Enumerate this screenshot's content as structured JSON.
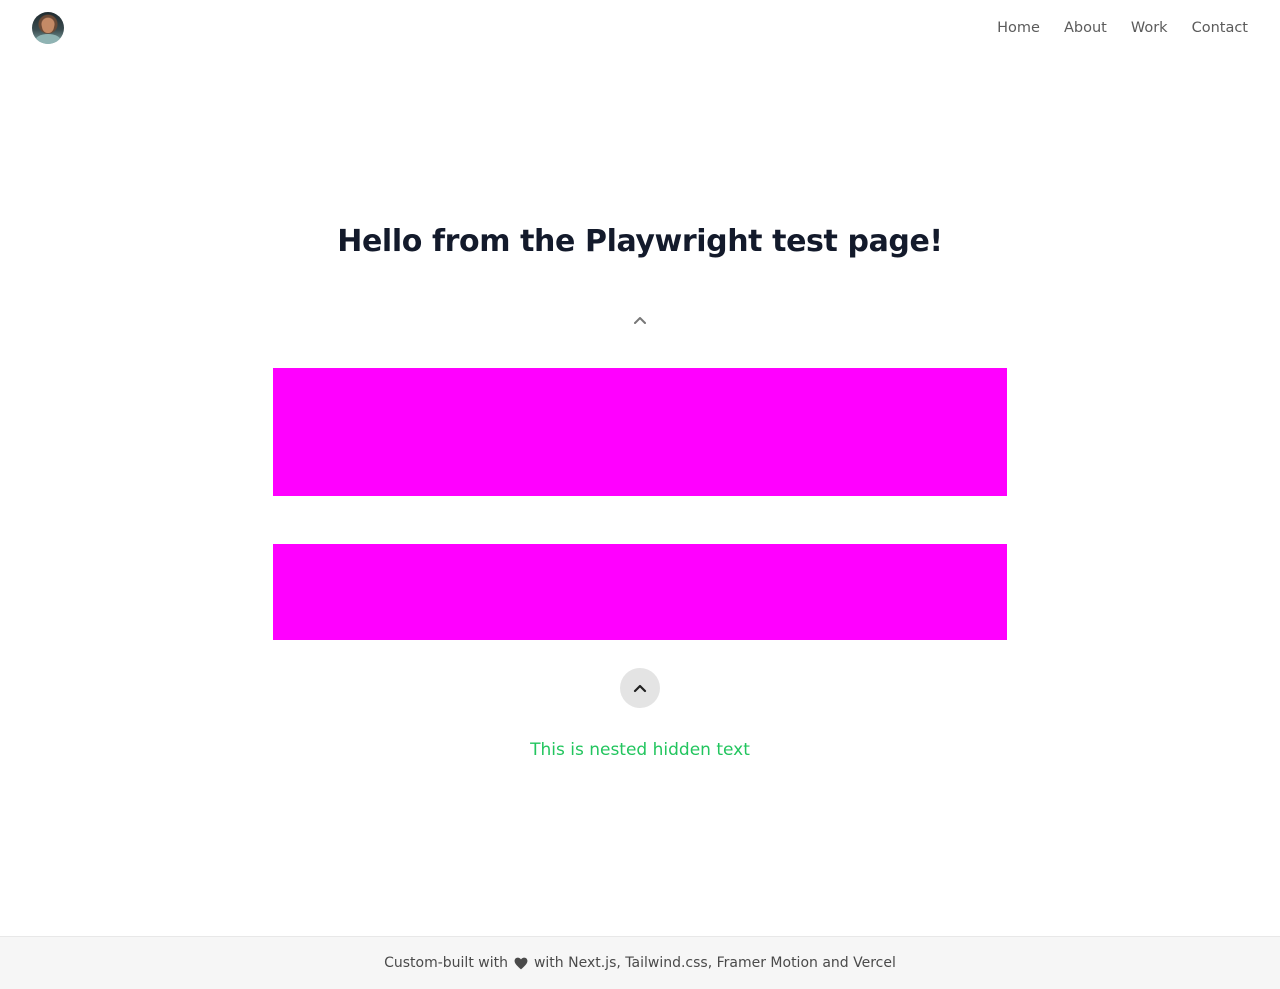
{
  "header": {
    "avatar_alt": "profile avatar",
    "nav": [
      {
        "label": "Home"
      },
      {
        "label": "About"
      },
      {
        "label": "Work"
      },
      {
        "label": "Contact"
      }
    ]
  },
  "main": {
    "title": "Hello from the Playwright test page!",
    "hidden_text": "This is nested hidden text",
    "block_color": "#ff00ff",
    "hidden_text_color": "#22c55e",
    "icons": {
      "top": "chevron-up-icon",
      "button": "chevron-up-icon"
    }
  },
  "footer": {
    "prefix": "Custom-built with",
    "suffix": "with Next.js, Tailwind.css, Framer Motion and Vercel",
    "icon": "heart-icon"
  }
}
